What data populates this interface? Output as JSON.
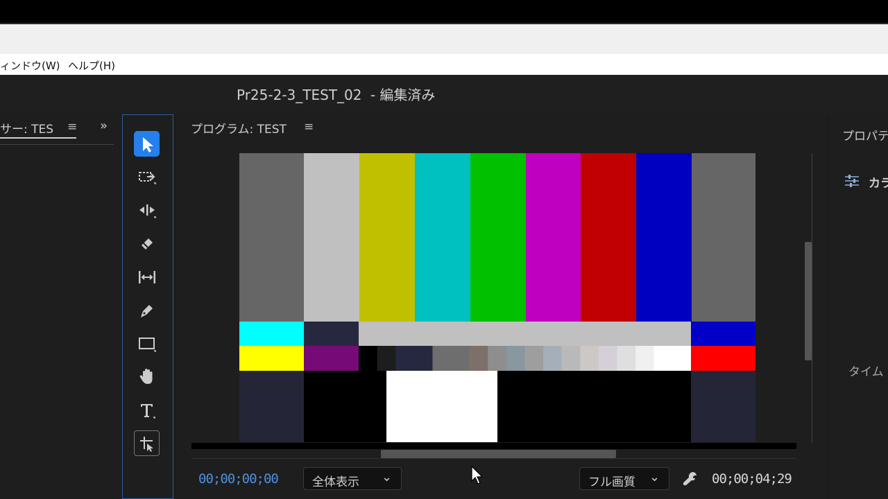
{
  "menu": {
    "items": [
      "ィンドウ(W)",
      "ヘルプ(H)"
    ]
  },
  "document": {
    "title": "Pr25-2-3_TEST_02",
    "status": "- 編集済み"
  },
  "left_panel": {
    "tab_label": "サー: TES",
    "menu_glyph": "≡",
    "overflow_glyph": "»"
  },
  "tools": [
    {
      "name": "selection-tool-icon",
      "active": true
    },
    {
      "name": "track-select-tool-icon"
    },
    {
      "name": "ripple-edit-tool-icon"
    },
    {
      "name": "razor-tool-icon"
    },
    {
      "name": "slip-tool-icon"
    },
    {
      "name": "pen-tool-icon"
    },
    {
      "name": "rectangle-tool-icon"
    },
    {
      "name": "hand-tool-icon"
    },
    {
      "name": "type-tool-icon"
    },
    {
      "name": "motion-tool-icon"
    }
  ],
  "program_monitor": {
    "title": "プログラム: TEST",
    "menu_glyph": "≡",
    "current_timecode": "00;00;00;00",
    "zoom_option": "全体表示",
    "quality_option": "フル画質",
    "duration_timecode": "00;00;04;29",
    "color_bars": {
      "top": [
        "#666666",
        "#c0c0c0",
        "#c0c000",
        "#00c0c0",
        "#00c000",
        "#c000c0",
        "#c00000",
        "#0000c0",
        "#666666"
      ],
      "mid1_left": "#00ffff",
      "mid1_left2": "#262840",
      "mid1_center": "#c0c0c0",
      "mid1_right": "#0000c8",
      "mid2_left": "#ffff00",
      "mid2_left2": "#760a76",
      "mid2_right": "#ff0000",
      "gray_steps": [
        "#000000",
        "#1d1d1d",
        "#262840",
        "#262840",
        "#6e6e6e",
        "#6e6e6e",
        "#7d706b",
        "#8e8e8e",
        "#8897a0",
        "#9e9e9e",
        "#a4afba",
        "#b9b9b9",
        "#cbc8c6",
        "#d5d0d8",
        "#dfdfdf",
        "#f0f0f0",
        "#ffffff",
        "#ffffff"
      ],
      "bottom": [
        "#242638",
        "#000000",
        "#ffffff",
        "#000000",
        "#242638"
      ]
    }
  },
  "right_panel": {
    "title": "プロパテ",
    "section_label": "カラ",
    "timeline_label": "タイム"
  }
}
